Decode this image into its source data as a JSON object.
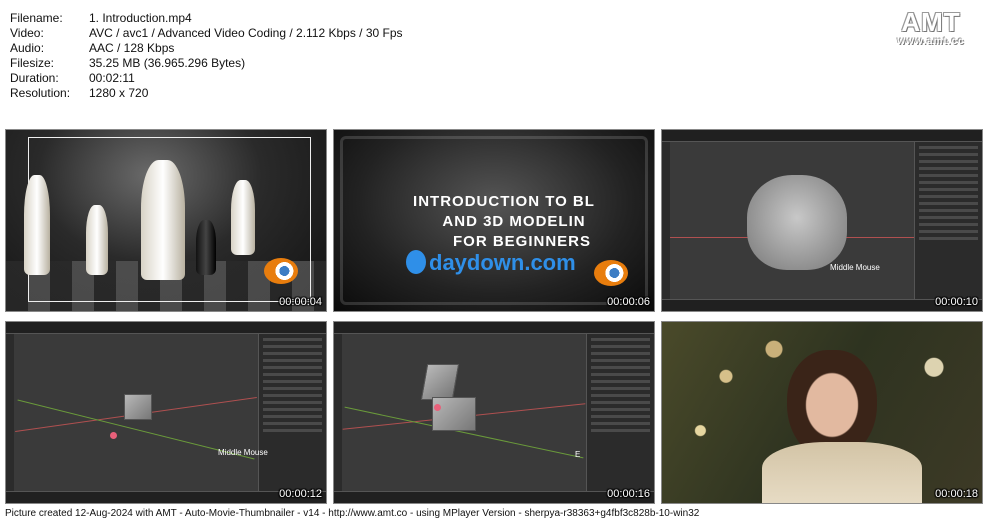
{
  "info": [
    {
      "key": "Filename:",
      "value": "1. Introduction.mp4"
    },
    {
      "key": "Video:",
      "value": "AVC / avc1 / Advanced Video Coding / 2.112 Kbps / 30 Fps"
    },
    {
      "key": "Audio:",
      "value": "AAC / 128 Kbps"
    },
    {
      "key": "Filesize:",
      "value": "35.25 MB (36.965.296 Bytes)"
    },
    {
      "key": "Duration:",
      "value": "00:02:11"
    },
    {
      "key": "Resolution:",
      "value": "1280 x 720"
    }
  ],
  "logo": {
    "main": "AMT",
    "url": "www.amt.cc"
  },
  "thumbs": [
    {
      "time": "00:00:04"
    },
    {
      "time": "00:00:06",
      "line1": "INTRODUCTION TO BL",
      "line2": "AND 3D MODELIN",
      "line3": "FOR BEGINNERS",
      "brand": "daydown.com"
    },
    {
      "time": "00:00:10",
      "overlay": "Middle Mouse"
    },
    {
      "time": "00:00:12",
      "overlay": "Middle Mouse"
    },
    {
      "time": "00:00:16",
      "overlay": "E"
    },
    {
      "time": "00:00:18"
    }
  ],
  "footer": "Picture created 12-Aug-2024 with AMT - Auto-Movie-Thumbnailer - v14 - http://www.amt.co - using MPlayer Version - sherpya-r38363+g4fbf3c828b-10-win32",
  "colors": {
    "axis_red": "#b05050",
    "axis_green": "#6a9a3a",
    "blender_orange": "#e87d0d",
    "brand_blue": "#2f8fe8"
  }
}
